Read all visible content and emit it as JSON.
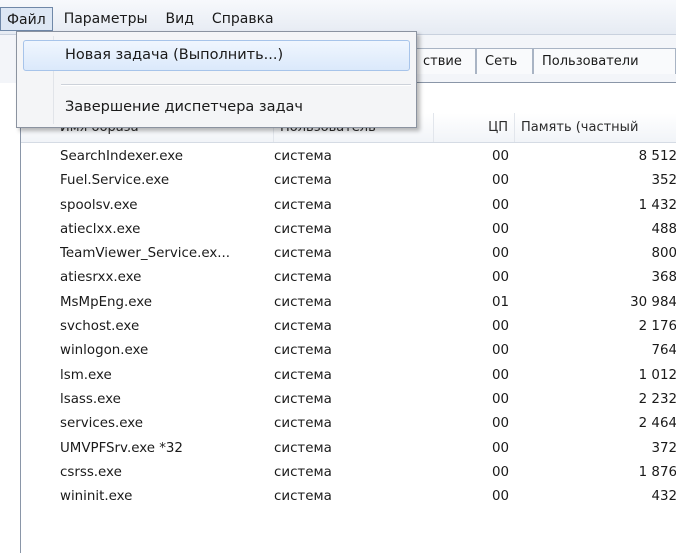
{
  "menubar": {
    "items": [
      {
        "label": "Файл"
      },
      {
        "label": "Параметры"
      },
      {
        "label": "Вид"
      },
      {
        "label": "Справка"
      }
    ]
  },
  "dropdown": {
    "items": [
      {
        "label": "Новая задача (Выполнить...)"
      },
      {
        "label": "Завершение диспетчера задач"
      }
    ]
  },
  "tabs": [
    {
      "label": "ствие"
    },
    {
      "label": "Сеть"
    },
    {
      "label": "Пользователи"
    }
  ],
  "table": {
    "columns": [
      "Имя образа",
      "Пользователь",
      "ЦП",
      "Память (частный"
    ],
    "rows": [
      {
        "name": "SearchIndexer.exe",
        "user": "система",
        "cpu": "00",
        "mem": "8 512"
      },
      {
        "name": "Fuel.Service.exe",
        "user": "система",
        "cpu": "00",
        "mem": "352"
      },
      {
        "name": "spoolsv.exe",
        "user": "система",
        "cpu": "00",
        "mem": "1 432"
      },
      {
        "name": "atieclxx.exe",
        "user": "система",
        "cpu": "00",
        "mem": "488"
      },
      {
        "name": "TeamViewer_Service.ex...",
        "user": "система",
        "cpu": "00",
        "mem": "800"
      },
      {
        "name": "atiesrxx.exe",
        "user": "система",
        "cpu": "00",
        "mem": "368"
      },
      {
        "name": "MsMpEng.exe",
        "user": "система",
        "cpu": "01",
        "mem": "30 984"
      },
      {
        "name": "svchost.exe",
        "user": "система",
        "cpu": "00",
        "mem": "2 176"
      },
      {
        "name": "winlogon.exe",
        "user": "система",
        "cpu": "00",
        "mem": "764"
      },
      {
        "name": "lsm.exe",
        "user": "система",
        "cpu": "00",
        "mem": "1 012"
      },
      {
        "name": "lsass.exe",
        "user": "система",
        "cpu": "00",
        "mem": "2 232"
      },
      {
        "name": "services.exe",
        "user": "система",
        "cpu": "00",
        "mem": "2 464"
      },
      {
        "name": "UMVPFSrv.exe *32",
        "user": "система",
        "cpu": "00",
        "mem": "372"
      },
      {
        "name": "csrss.exe",
        "user": "система",
        "cpu": "00",
        "mem": "1 876"
      },
      {
        "name": "wininit.exe",
        "user": "система",
        "cpu": "00",
        "mem": "432"
      }
    ]
  }
}
